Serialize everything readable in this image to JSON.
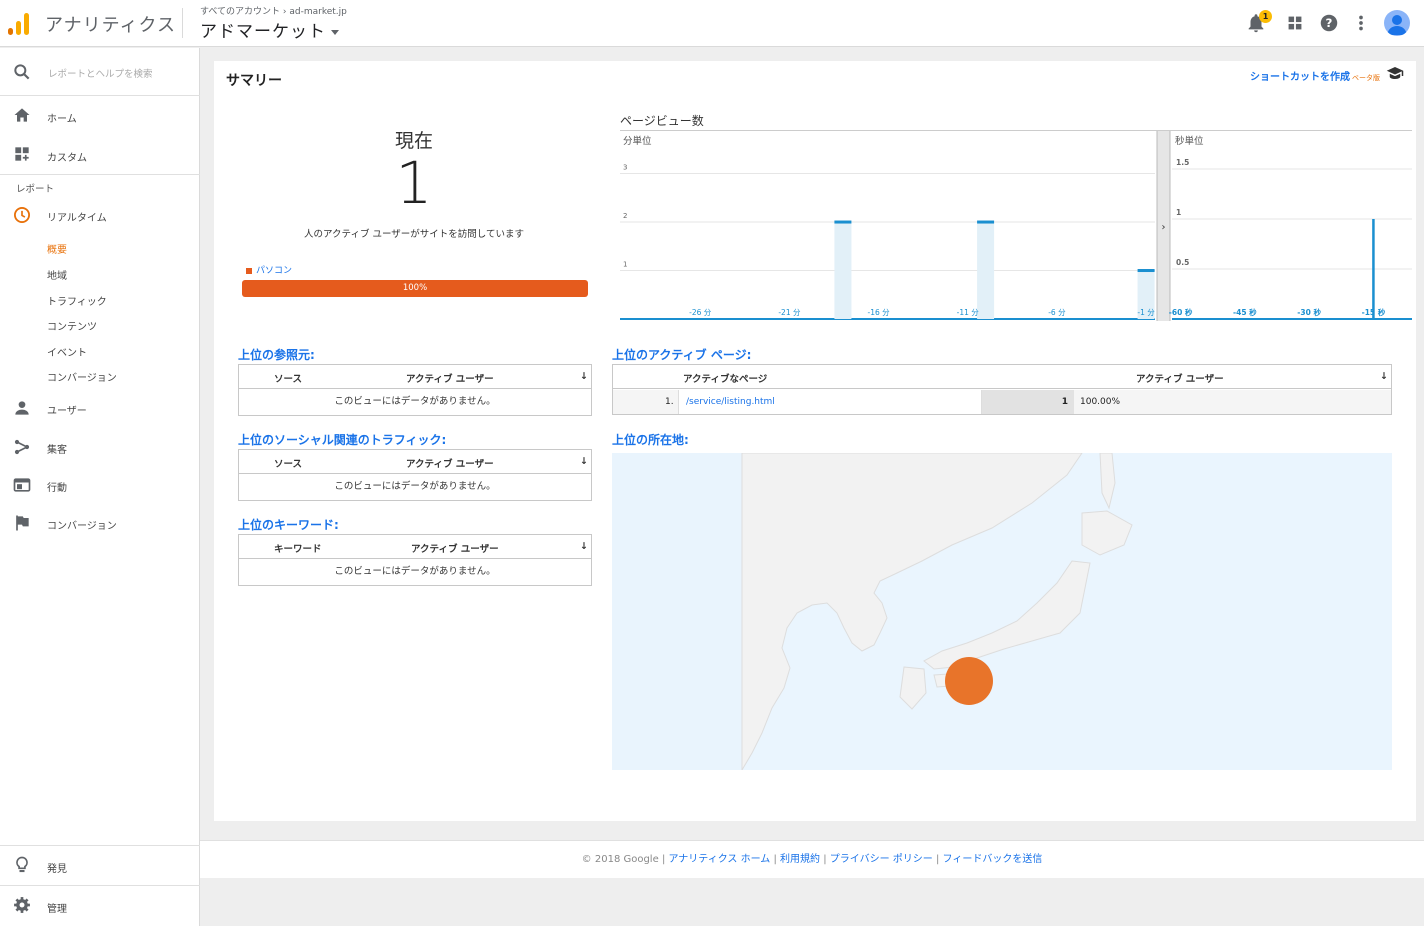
{
  "header": {
    "app_name": "アナリティクス",
    "breadcrumb_all": "すべてのアカウント",
    "breadcrumb_sep": "›",
    "breadcrumb_account": "ad-market.jp",
    "property": "アドマーケット",
    "notification_count": "1"
  },
  "sidebar": {
    "search_placeholder": "レポートとヘルプを検索",
    "home": "ホーム",
    "custom": "カスタム",
    "reports_heading": "レポート",
    "realtime": "リアルタイム",
    "realtime_items": [
      "概要",
      "地域",
      "トラフィック",
      "コンテンツ",
      "イベント",
      "コンバージョン"
    ],
    "audience": "ユーザー",
    "acquisition": "集客",
    "behavior": "行動",
    "conversions": "コンバージョン",
    "discover": "発見",
    "admin": "管理"
  },
  "main": {
    "title": "サマリー",
    "shortcut": "ショートカットを作成",
    "beta": "ベータ版",
    "now_title": "現在",
    "now_count": "1",
    "now_desc": "人のアクティブ ユーザーがサイトを訪問しています",
    "device_name": "パソコン",
    "device_percent": "100%"
  },
  "chart_data": [
    {
      "type": "bar",
      "title": "ページビュー数",
      "subtitle": "分単位",
      "x_tick_labels": [
        "-26 分",
        "-21 分",
        "-16 分",
        "-11 分",
        "-6 分",
        "-1 分"
      ],
      "y_ticks": [
        "1",
        "2",
        "3"
      ],
      "ylim": [
        0,
        3.3
      ],
      "x": [
        -30,
        -29,
        -28,
        -27,
        -26,
        -25,
        -24,
        -23,
        -22,
        -21,
        -20,
        -19,
        -18,
        -17,
        -16,
        -15,
        -14,
        -13,
        -12,
        -11,
        -10,
        -9,
        -8,
        -7,
        -6,
        -5,
        -4,
        -3,
        -2,
        -1
      ],
      "values": [
        0,
        0,
        0,
        0,
        0,
        0,
        0,
        0,
        0,
        0,
        0,
        0,
        2,
        0,
        0,
        0,
        0,
        0,
        0,
        0,
        2,
        0,
        0,
        0,
        0,
        0,
        0,
        0,
        0,
        1
      ],
      "color": "#1a8fd0"
    },
    {
      "type": "bar",
      "subtitle": "秒単位",
      "x_tick_labels": [
        "-60 秒",
        "-45 秒",
        "-30 秒",
        "-15 秒"
      ],
      "y_ticks": [
        "0.5",
        "1",
        "1.5"
      ],
      "ylim": [
        0,
        1.6
      ],
      "x": [
        -60,
        -15
      ],
      "values": [
        0,
        1
      ],
      "color": "#1a8fd0"
    }
  ],
  "referrals": {
    "title": "上位の参照元:",
    "col_source": "ソース",
    "col_users": "アクティブ ユーザー",
    "empty": "このビューにはデータがありません。"
  },
  "social": {
    "title": "上位のソーシャル関連のトラフィック:",
    "col_source": "ソース",
    "col_users": "アクティブ ユーザー",
    "empty": "このビューにはデータがありません。"
  },
  "keywords": {
    "title": "上位のキーワード:",
    "col_keyword": "キーワード",
    "col_users": "アクティブ ユーザー",
    "empty": "このビューにはデータがありません。"
  },
  "pages": {
    "title": "上位のアクティブ ページ:",
    "col_page": "アクティブなページ",
    "col_users": "アクティブ ユーザー",
    "rows": [
      {
        "index": "1.",
        "page": "/service/listing.html",
        "users": "1",
        "percent": "100.00%"
      }
    ]
  },
  "locations": {
    "title": "上位の所在地:"
  },
  "footer": {
    "copyright": "© 2018 Google",
    "sep": "|",
    "link_home": "アナリティクス ホーム",
    "link_terms": "利用規約",
    "link_privacy": "プライバシー ポリシー",
    "link_feedback": "フィードバックを送信"
  },
  "colors": {
    "accent_orange": "#e8710a",
    "link_blue": "#1a73e8",
    "bar_blue": "#1a8fd0",
    "device_bar": "#e55b1d"
  }
}
